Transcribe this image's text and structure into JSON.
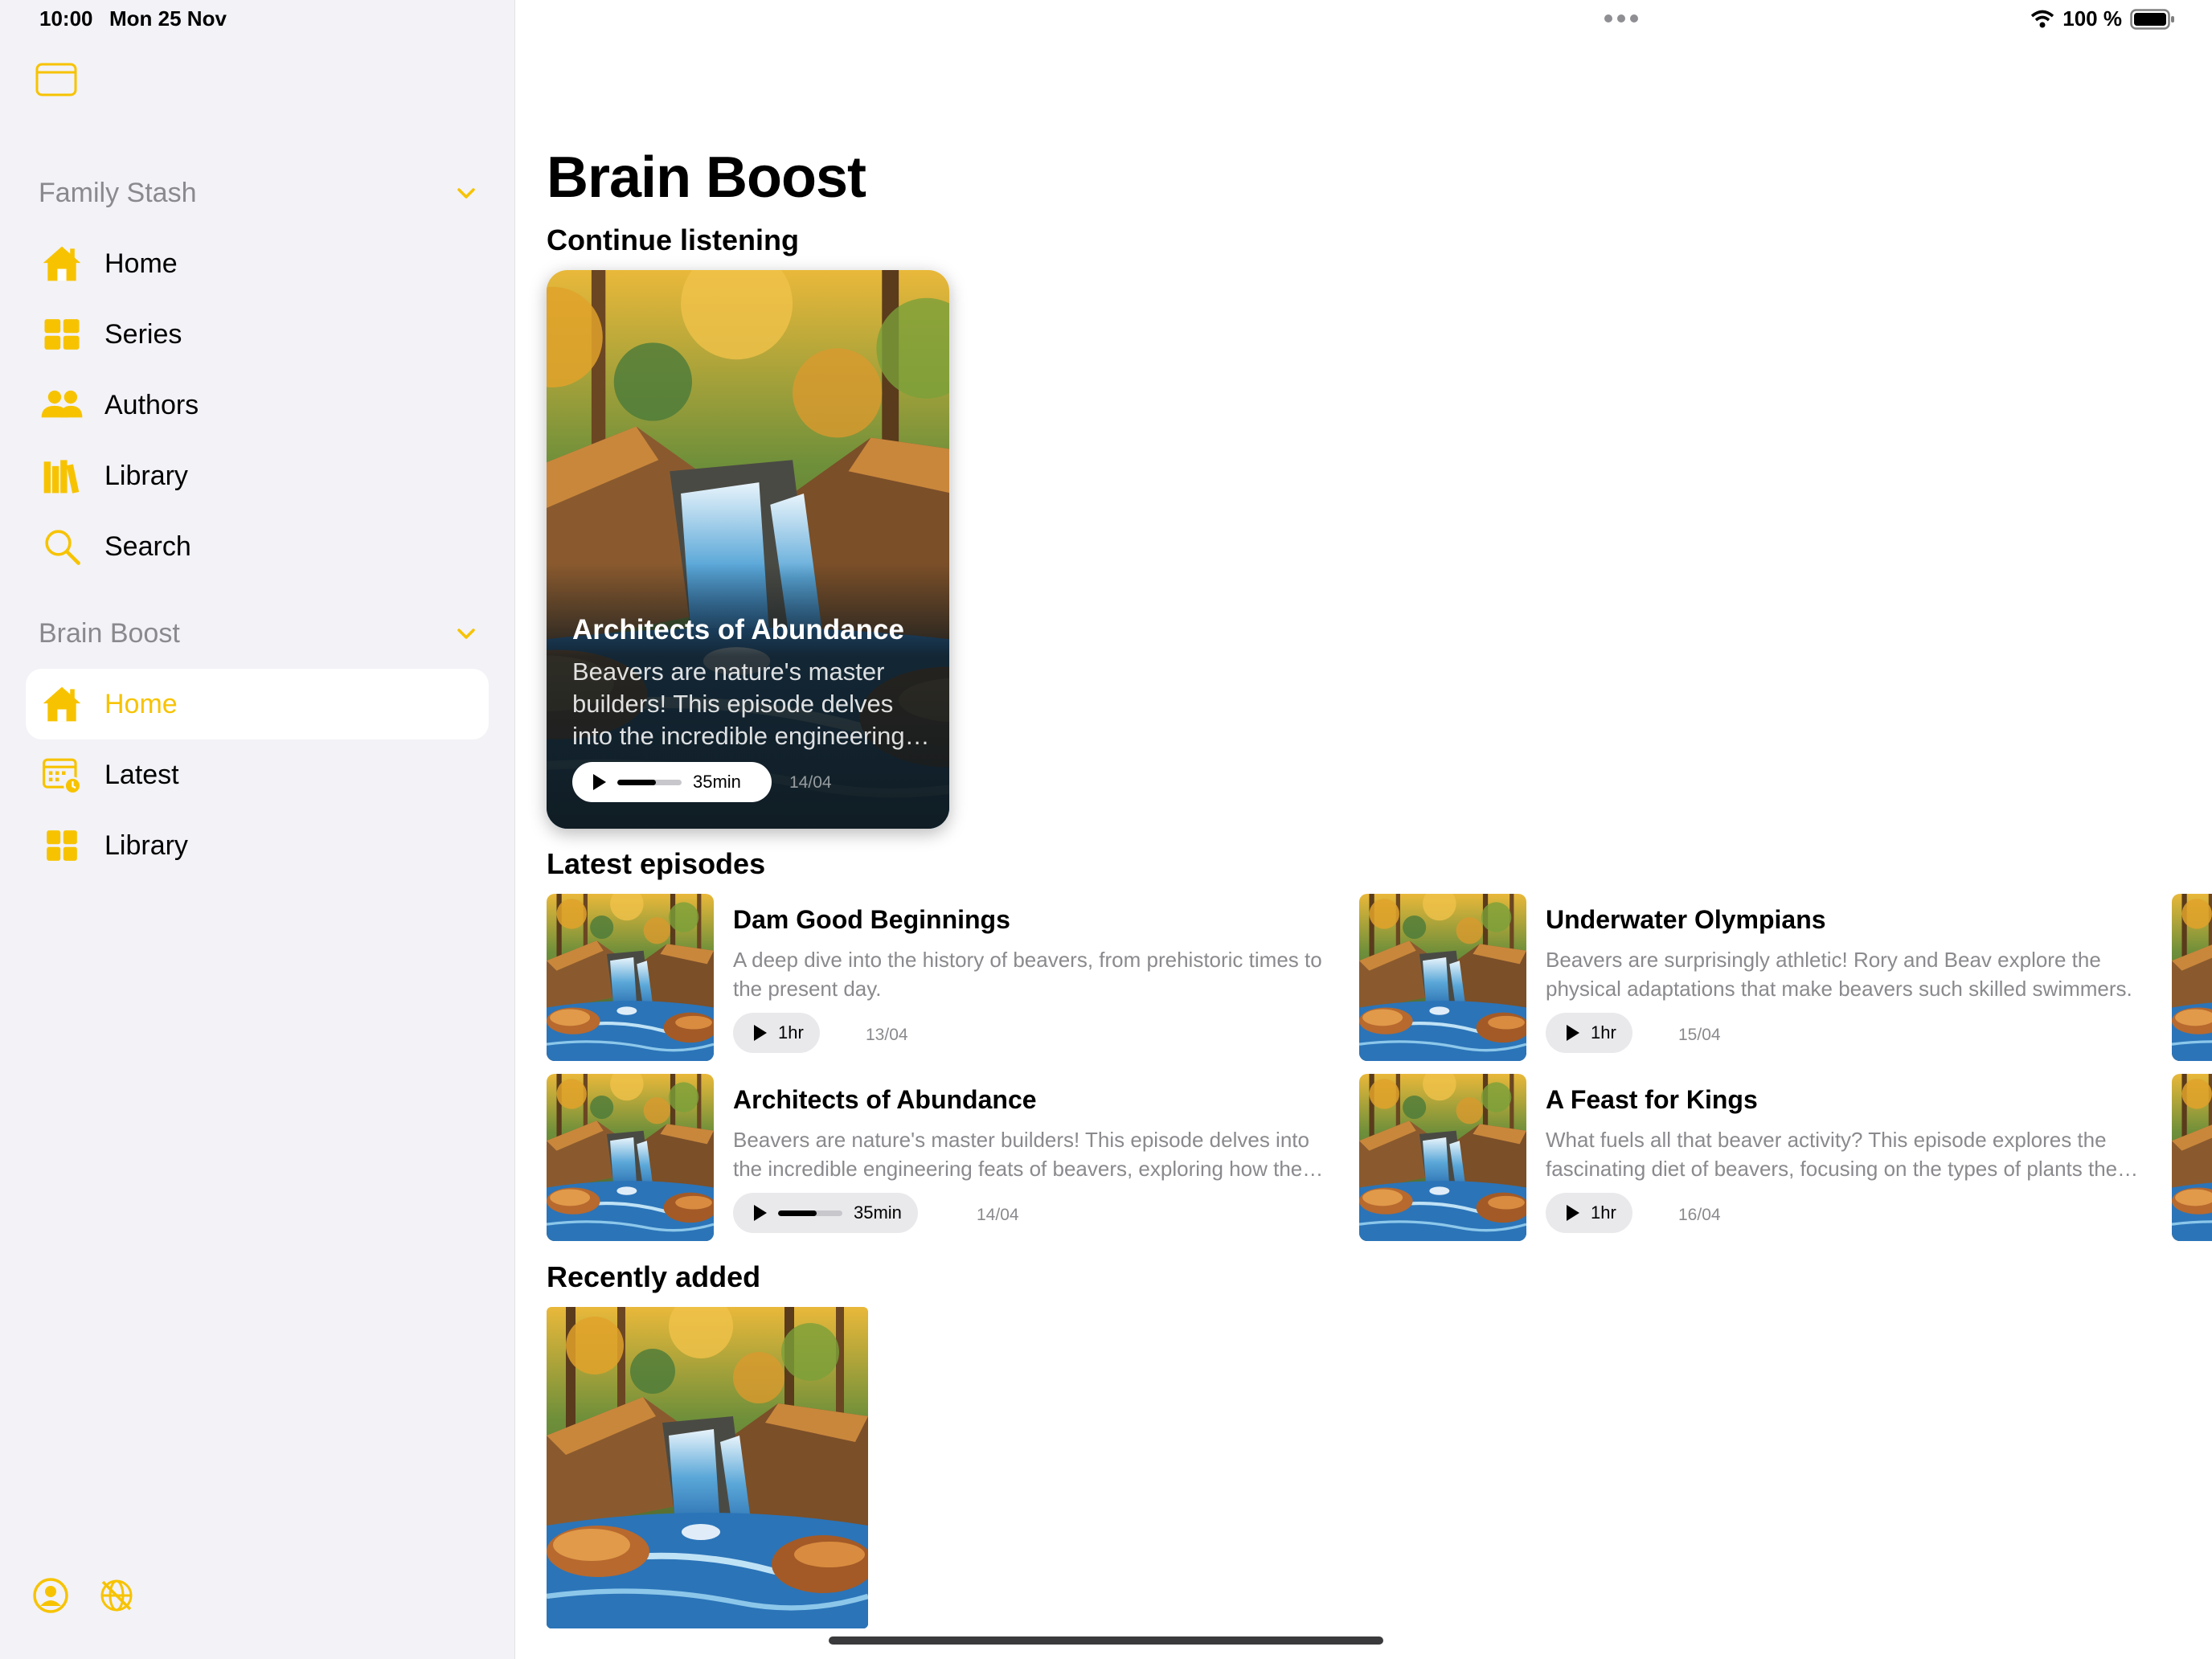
{
  "status_bar": {
    "time": "10:00",
    "date": "Mon 25 Nov",
    "battery": "100 %"
  },
  "sidebar": {
    "sections": [
      {
        "title": "Family Stash",
        "items": [
          {
            "label": "Home",
            "icon": "house-icon"
          },
          {
            "label": "Series",
            "icon": "grid-icon"
          },
          {
            "label": "Authors",
            "icon": "people-icon"
          },
          {
            "label": "Library",
            "icon": "books-icon"
          },
          {
            "label": "Search",
            "icon": "magnifier-icon"
          }
        ]
      },
      {
        "title": "Brain Boost",
        "items": [
          {
            "label": "Home",
            "icon": "house-icon",
            "selected": true
          },
          {
            "label": "Latest",
            "icon": "calendar-clock-icon"
          },
          {
            "label": "Library",
            "icon": "grid-icon"
          }
        ]
      }
    ]
  },
  "main": {
    "title": "Brain Boost",
    "continue_listening": {
      "heading": "Continue listening",
      "card": {
        "title": "Architects of Abundance",
        "description": "Beavers are nature's master builders! This episode delves into the incredible engineering feats of beavers, exploring how they shape their environment.",
        "duration": "35min",
        "progress": 0.6,
        "date": "14/04"
      }
    },
    "latest_episodes": {
      "heading": "Latest episodes",
      "items": [
        {
          "title": "Dam Good Beginnings",
          "description": "A deep dive into the history of beavers, from prehistoric times to the present day.",
          "duration": "1hr",
          "date": "13/04"
        },
        {
          "title": "Underwater Olympians",
          "description": "Beavers are surprisingly athletic! Rory and Beav explore the physical adaptations that make beavers such skilled swimmers.",
          "duration": "1hr",
          "date": "15/04"
        },
        {
          "title": "Architects of Abundance",
          "description": "Beavers are nature's master builders! This episode delves into the incredible engineering feats of beavers, exploring how they shape their environment.",
          "duration": "35min",
          "progress": 0.6,
          "date": "14/04"
        },
        {
          "title": "A Feast for Kings",
          "description": "What fuels all that beaver activity? This episode explores the fascinating diet of beavers, focusing on the types of plants they eat.",
          "duration": "1hr",
          "date": "16/04"
        }
      ]
    },
    "recently_added": {
      "heading": "Recently added"
    }
  },
  "colors": {
    "accent": "#f7c300",
    "sidebar_bg": "#f2f2f7",
    "secondary_text": "#8a8a8e"
  }
}
